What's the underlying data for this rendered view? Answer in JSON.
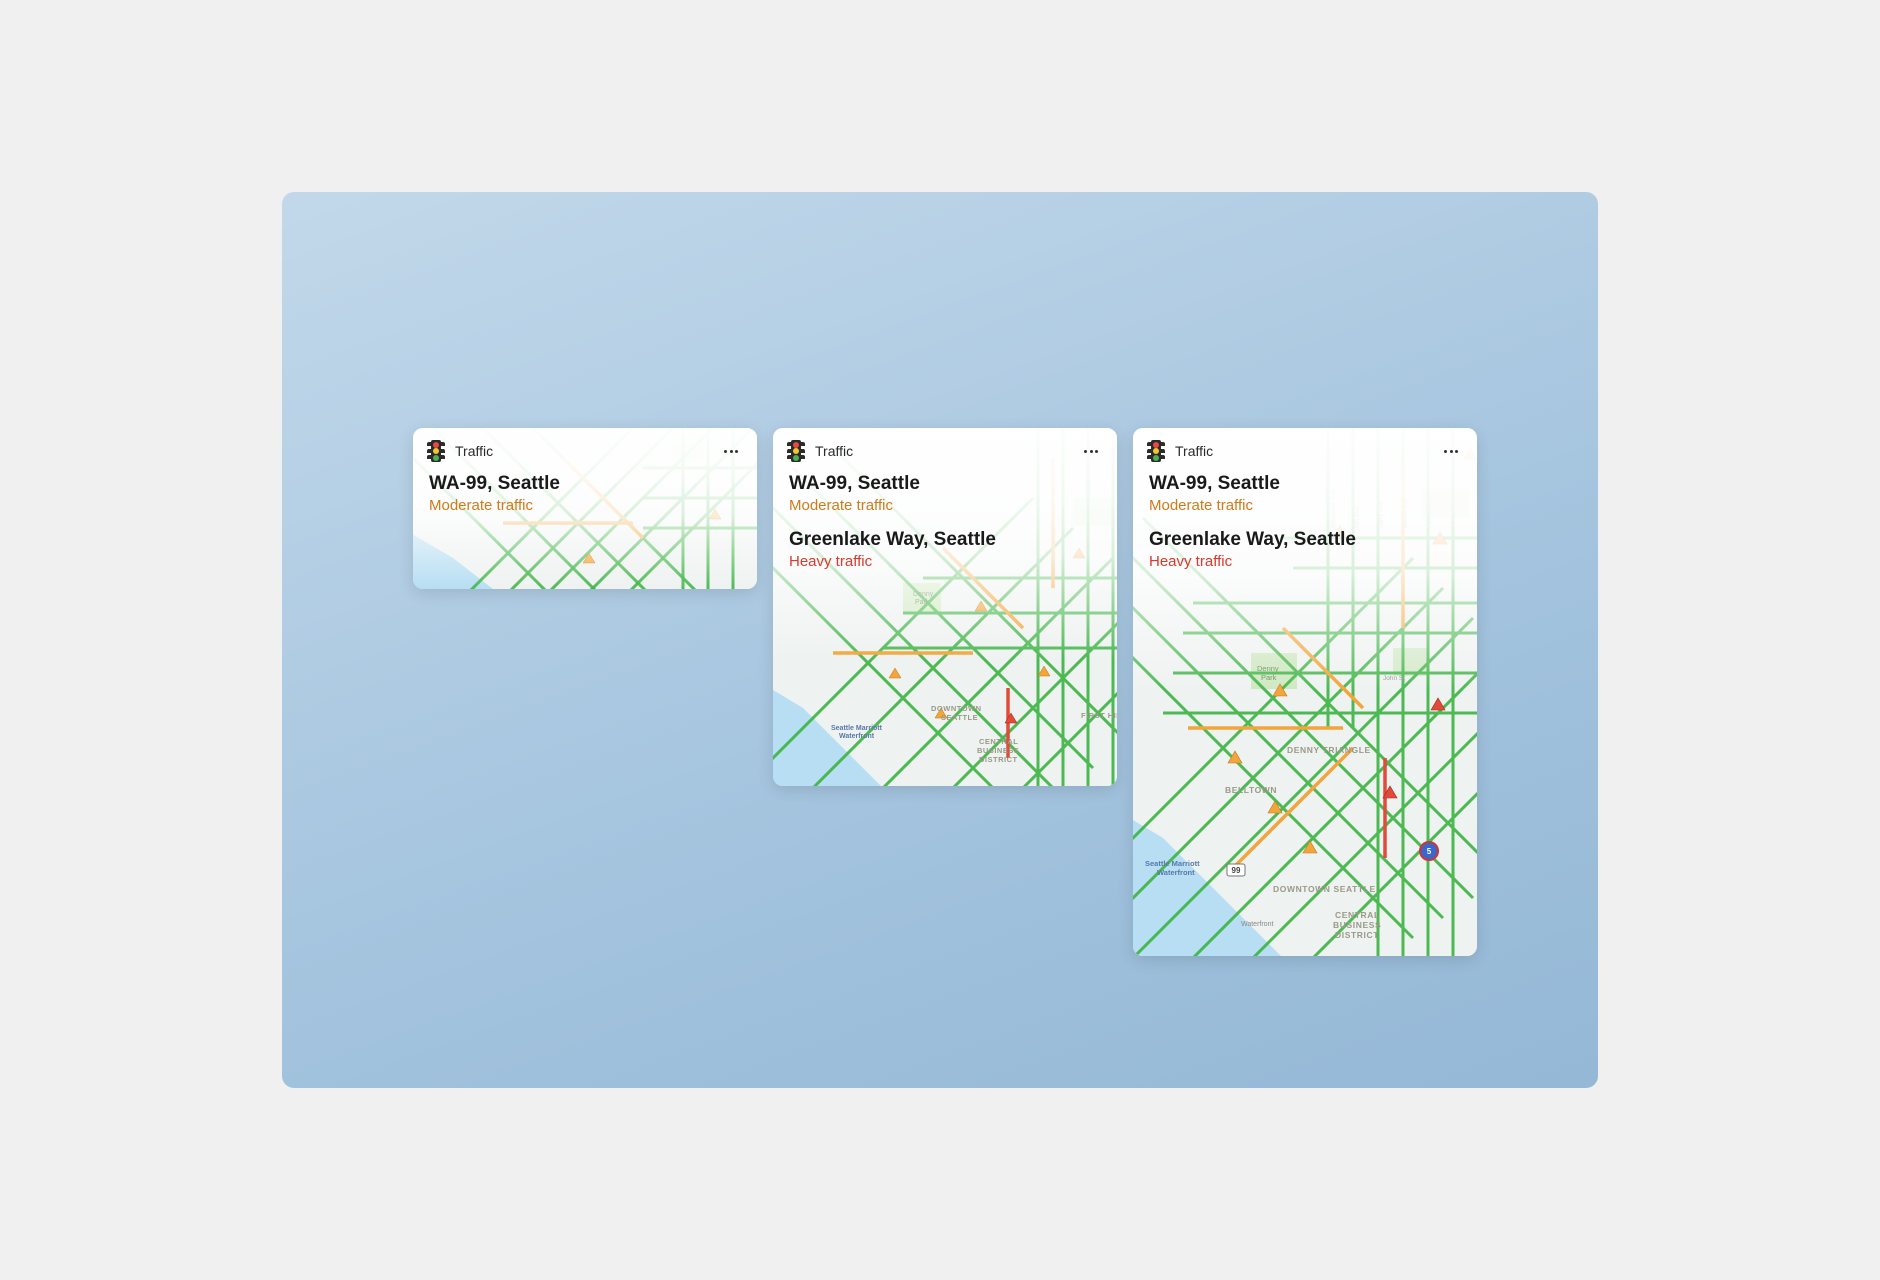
{
  "widgets": [
    {
      "size": "small",
      "title": "Traffic",
      "icon": "traffic-light-icon",
      "routes": [
        {
          "name": "WA-99, Seattle",
          "status": "Moderate traffic",
          "severity": "moderate"
        }
      ]
    },
    {
      "size": "medium",
      "title": "Traffic",
      "icon": "traffic-light-icon",
      "routes": [
        {
          "name": "WA-99, Seattle",
          "status": "Moderate traffic",
          "severity": "moderate"
        },
        {
          "name": "Greenlake Way, Seattle",
          "status": "Heavy traffic",
          "severity": "heavy"
        }
      ]
    },
    {
      "size": "large",
      "title": "Traffic",
      "icon": "traffic-light-icon",
      "routes": [
        {
          "name": "WA-99, Seattle",
          "status": "Moderate traffic",
          "severity": "moderate"
        },
        {
          "name": "Greenlake Way, Seattle",
          "status": "Heavy traffic",
          "severity": "heavy"
        }
      ],
      "map_labels": [
        "DENNY TRIANGLE",
        "BELLTOWN",
        "DOWNTOWN SEATTLE",
        "CENTRAL BUSINESS DISTRICT",
        "Seattle Marriott Waterfront"
      ]
    }
  ],
  "colors": {
    "road_clear": "#3fb546",
    "road_slow": "#f2a53c",
    "road_heavy": "#e04b3a",
    "water": "#b7def2",
    "land": "#eef2f0",
    "park": "#c9e6b8"
  }
}
